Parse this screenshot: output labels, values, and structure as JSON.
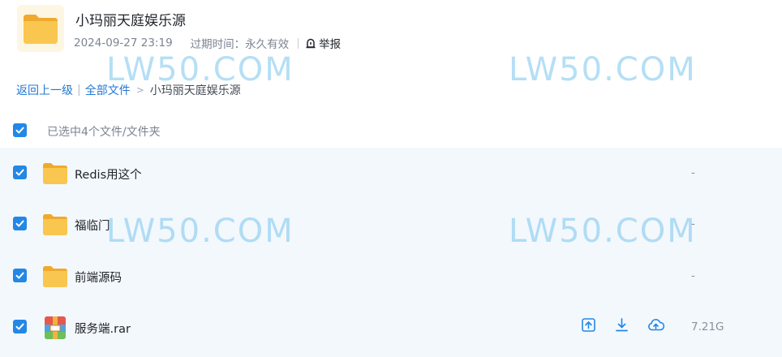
{
  "header": {
    "title": "小玛丽天庭娱乐源",
    "date": "2024-09-27 23:19",
    "expire_label": "过期时间：",
    "expire_value": "永久有效",
    "report_label": "举报"
  },
  "watermark": "LW50.COM",
  "breadcrumb": {
    "back": "返回上一级",
    "all_files": "全部文件",
    "separator": ">",
    "current": "小玛丽天庭娱乐源"
  },
  "selection": {
    "label": "已选中4个文件/文件夹"
  },
  "files": [
    {
      "name": "Redis用这个",
      "size": "-",
      "icon": "folder-icon",
      "checked": true
    },
    {
      "name": "福临门",
      "size": "-",
      "icon": "folder-icon",
      "checked": true
    },
    {
      "name": "前端源码",
      "size": "-",
      "icon": "folder-icon",
      "checked": true
    },
    {
      "name": "服务端.rar",
      "size": "7.21G",
      "icon": "archive-icon",
      "checked": true
    }
  ],
  "colors": {
    "accent": "#2387e6",
    "link": "#2478d4",
    "folder": "#f9c74f",
    "list_background": "#f3f8fd",
    "watermark": "#78c4ec"
  }
}
